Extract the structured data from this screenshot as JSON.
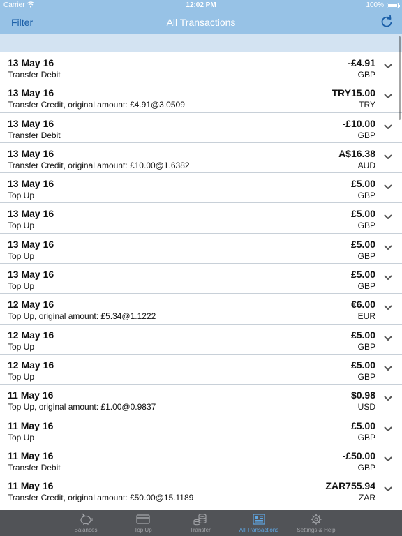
{
  "status_bar": {
    "carrier": "Carrier",
    "time": "12:02 PM",
    "battery": "100%"
  },
  "nav": {
    "filter_label": "Filter",
    "title": "All Transactions"
  },
  "transactions": [
    {
      "date": "13 May 16",
      "description": "Transfer Debit",
      "amount": "-£4.91",
      "currency": "GBP"
    },
    {
      "date": "13 May 16",
      "description": "Transfer Credit, original amount: £4.91@3.0509",
      "amount": "TRY15.00",
      "currency": "TRY"
    },
    {
      "date": "13 May 16",
      "description": "Transfer Debit",
      "amount": "-£10.00",
      "currency": "GBP"
    },
    {
      "date": "13 May 16",
      "description": "Transfer Credit, original amount: £10.00@1.6382",
      "amount": "A$16.38",
      "currency": "AUD"
    },
    {
      "date": "13 May 16",
      "description": "Top Up",
      "amount": "£5.00",
      "currency": "GBP"
    },
    {
      "date": "13 May 16",
      "description": "Top Up",
      "amount": "£5.00",
      "currency": "GBP"
    },
    {
      "date": "13 May 16",
      "description": "Top Up",
      "amount": "£5.00",
      "currency": "GBP"
    },
    {
      "date": "13 May 16",
      "description": "Top Up",
      "amount": "£5.00",
      "currency": "GBP"
    },
    {
      "date": "12 May 16",
      "description": "Top Up, original amount: £5.34@1.1222",
      "amount": "€6.00",
      "currency": "EUR"
    },
    {
      "date": "12 May 16",
      "description": "Top Up",
      "amount": "£5.00",
      "currency": "GBP"
    },
    {
      "date": "12 May 16",
      "description": "Top Up",
      "amount": "£5.00",
      "currency": "GBP"
    },
    {
      "date": "11 May 16",
      "description": "Top Up, original amount: £1.00@0.9837",
      "amount": "$0.98",
      "currency": "USD"
    },
    {
      "date": "11 May 16",
      "description": "Top Up",
      "amount": "£5.00",
      "currency": "GBP"
    },
    {
      "date": "11 May 16",
      "description": "Transfer Debit",
      "amount": "-£50.00",
      "currency": "GBP"
    },
    {
      "date": "11 May 16",
      "description": "Transfer Credit, original amount: £50.00@15.1189",
      "amount": "ZAR755.94",
      "currency": "ZAR"
    }
  ],
  "tabs": [
    {
      "label": "Balances",
      "icon": "piggy-bank-icon",
      "active": false
    },
    {
      "label": "Top Up",
      "icon": "card-icon",
      "active": false
    },
    {
      "label": "Transfer",
      "icon": "coins-icon",
      "active": false
    },
    {
      "label": "All Transactions",
      "icon": "transactions-icon",
      "active": true
    },
    {
      "label": "Settings & Help",
      "icon": "gear-icon",
      "active": false
    }
  ],
  "colors": {
    "nav_bg": "#97c2e6",
    "section_bg": "#d3e3f2",
    "tab_bg": "#515357",
    "tab_active": "#5fa6e2",
    "tab_inactive": "#a2a4a8",
    "filter_text": "#1b5fa8"
  }
}
